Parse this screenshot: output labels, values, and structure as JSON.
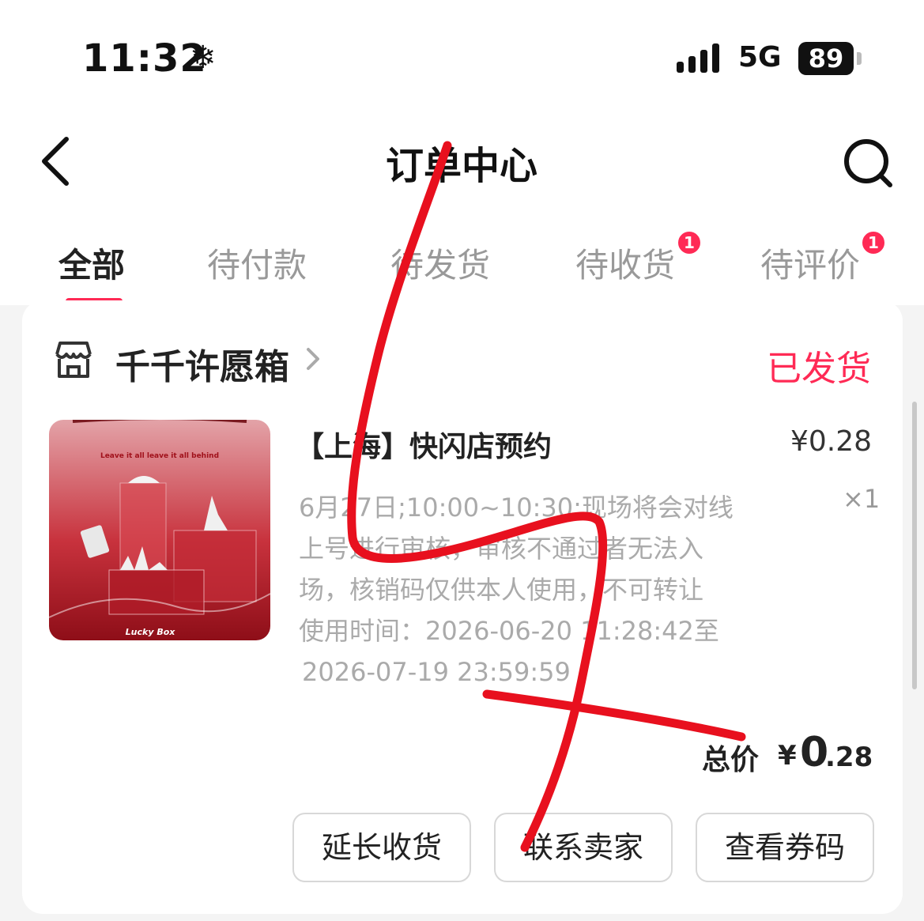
{
  "status_bar": {
    "time": "11:32",
    "indicator_icon": "snowflake-icon",
    "network": "5G",
    "battery": "89"
  },
  "nav": {
    "back_icon": "back-arrow-icon",
    "title": "订单中心",
    "search_icon": "search-icon"
  },
  "tabs": [
    {
      "label": "全部",
      "active": true
    },
    {
      "label": "待付款"
    },
    {
      "label": "待发货"
    },
    {
      "label": "待收货",
      "badge": "1"
    },
    {
      "label": "待评价",
      "badge": "1"
    }
  ],
  "order": {
    "shop_icon": "shop-icon",
    "shop_name": "千千许愿箱",
    "status": "已发货",
    "product": {
      "name": "【上海】快闪店预约",
      "price": "¥0.28",
      "quantity": "×1",
      "image_text": {
        "headline": "Leave it all leave it all behind",
        "brand": "Lucky Box"
      },
      "description_lines": [
        "6月27日;10:00~10:30;现场将会对线",
        "上号进行审核，审核不通过者无法入",
        "场，核销码仅供本人使用，不可转让",
        "使用时间：2026-06-20 11:28:42至",
        "2026-07-19 23:59:59"
      ]
    },
    "total": {
      "label": "总价",
      "currency": "¥",
      "integer": "0",
      "decimal": ".28"
    },
    "buttons": {
      "extend": "延长收货",
      "contact": "联系卖家",
      "coupon": "查看券码"
    }
  },
  "colors": {
    "accent": "#ff2a55",
    "scribble": "#e8101e",
    "muted_text": "#aaaaaa",
    "background": "#f4f4f4"
  }
}
